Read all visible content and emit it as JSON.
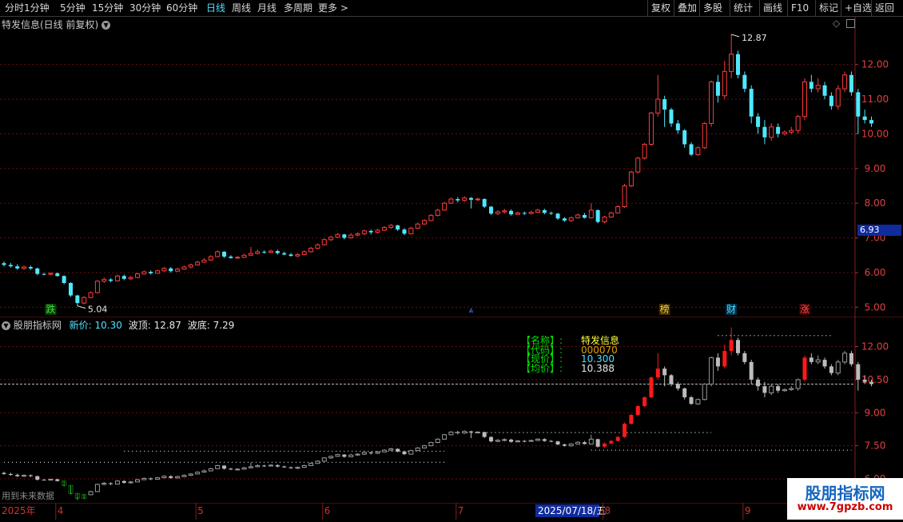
{
  "toolbar": {
    "left": [
      {
        "label": "分时",
        "active": false
      },
      {
        "label": "1分钟",
        "active": false
      },
      {
        "label": "5分钟",
        "active": false
      },
      {
        "label": "15分钟",
        "active": false
      },
      {
        "label": "30分钟",
        "active": false
      },
      {
        "label": "60分钟",
        "active": false
      },
      {
        "label": "日线",
        "active": true
      },
      {
        "label": "周线",
        "active": false
      },
      {
        "label": "月线",
        "active": false
      },
      {
        "label": "多周期",
        "active": false
      },
      {
        "label": "更多 >",
        "active": false
      }
    ],
    "right": [
      {
        "label": "复权"
      },
      {
        "label": "叠加"
      },
      {
        "label": "多股"
      },
      {
        "label": "统计"
      },
      {
        "label": "画线"
      },
      {
        "label": "F10"
      },
      {
        "label": "标记"
      },
      {
        "label": "+自选"
      },
      {
        "label": "返回"
      }
    ]
  },
  "main_header": {
    "title": "特发信息(日线 前复权)"
  },
  "sub_header": {
    "name": "股朋指标网",
    "price_label": "新价: 10.30",
    "peak_label": "波顶: 12.87",
    "trough_label": "波底: 7.29"
  },
  "info_box": [
    {
      "key": "【名称】:",
      "value": "特发信息",
      "color": "#ffff40"
    },
    {
      "key": "【代码】:",
      "value": "000070",
      "color": "#e0a000"
    },
    {
      "key": "【现价】:",
      "value": "10.300",
      "color": "#4fe0ff"
    },
    {
      "key": "【均价】:",
      "value": "10.388",
      "color": "#e8e8e8"
    }
  ],
  "future_label": "用到未来数据",
  "current_price_tag": "6.93",
  "watermark": {
    "title": "股朋指标网",
    "url": "www.7gpzb.com"
  },
  "main_markers": [
    {
      "text": "跌",
      "color": "#3ce03c",
      "bg": "#0a3a0a",
      "index": 7
    },
    {
      "text": "榜",
      "color": "#ffd040",
      "bg": "#3a2a00",
      "index": 99
    },
    {
      "text": "财",
      "color": "#4fe0ff",
      "bg": "#00304a",
      "index": 109
    },
    {
      "text": "涨",
      "color": "#ff5050",
      "bg": "#3a0000",
      "index": 120
    }
  ],
  "main_annotations": {
    "high": "12.87",
    "low": "5.04"
  },
  "time_axis": {
    "labels": [
      {
        "text": "2025年",
        "index": 0
      },
      {
        "text": "4",
        "index": 8
      },
      {
        "text": "5",
        "index": 29
      },
      {
        "text": "6",
        "index": 48
      },
      {
        "text": "7",
        "index": 68
      },
      {
        "text": "2025/07/18/五",
        "index": 80,
        "highlight": true
      },
      {
        "text": "8",
        "index": 90
      },
      {
        "text": "9",
        "index": 111
      }
    ]
  },
  "chart_data": {
    "type": "candlestick",
    "main_y_ticks": [
      5.0,
      6.0,
      7.0,
      8.0,
      9.0,
      10.0,
      11.0,
      12.0
    ],
    "main_ylim": [
      4.8,
      13.1
    ],
    "sub_y_ticks": [
      6.0,
      7.5,
      9.0,
      10.5,
      12.0
    ],
    "sub_ylim": [
      6.0,
      13.0
    ],
    "sub_ref_line": 10.3,
    "peak": 12.87,
    "trough": 7.29,
    "candles": [
      [
        6.27,
        6.22,
        6.32,
        6.18
      ],
      [
        6.22,
        6.18,
        6.28,
        6.14
      ],
      [
        6.18,
        6.12,
        6.24,
        6.08
      ],
      [
        6.12,
        6.16,
        6.2,
        6.08
      ],
      [
        6.16,
        6.12,
        6.2,
        6.08
      ],
      [
        6.12,
        5.96,
        6.14,
        5.92
      ],
      [
        5.96,
        5.95,
        5.99,
        5.92
      ],
      [
        5.95,
        5.98,
        6.0,
        5.92
      ],
      [
        5.98,
        5.9,
        6.0,
        5.88
      ],
      [
        5.9,
        5.7,
        5.92,
        5.66
      ],
      [
        5.7,
        5.34,
        5.72,
        5.3
      ],
      [
        5.34,
        5.12,
        5.36,
        5.04
      ],
      [
        5.12,
        5.28,
        5.32,
        5.08
      ],
      [
        5.28,
        5.42,
        5.46,
        5.26
      ],
      [
        5.42,
        5.75,
        5.78,
        5.4
      ],
      [
        5.75,
        5.8,
        5.86,
        5.7
      ],
      [
        5.8,
        5.76,
        5.84,
        5.72
      ],
      [
        5.76,
        5.9,
        5.94,
        5.74
      ],
      [
        5.9,
        5.82,
        5.94,
        5.78
      ],
      [
        5.82,
        5.86,
        5.9,
        5.78
      ],
      [
        5.86,
        5.96,
        6.0,
        5.84
      ],
      [
        5.96,
        6.02,
        6.06,
        5.94
      ],
      [
        6.02,
        5.98,
        6.06,
        5.94
      ],
      [
        5.98,
        6.05,
        6.08,
        5.96
      ],
      [
        6.05,
        6.12,
        6.16,
        6.02
      ],
      [
        6.12,
        6.04,
        6.16,
        6.0
      ],
      [
        6.04,
        6.1,
        6.14,
        6.02
      ],
      [
        6.1,
        6.16,
        6.2,
        6.08
      ],
      [
        6.16,
        6.22,
        6.26,
        6.12
      ],
      [
        6.22,
        6.3,
        6.34,
        6.2
      ],
      [
        6.3,
        6.36,
        6.42,
        6.28
      ],
      [
        6.36,
        6.46,
        6.5,
        6.34
      ],
      [
        6.46,
        6.6,
        6.64,
        6.44
      ],
      [
        6.6,
        6.46,
        6.62,
        6.42
      ],
      [
        6.46,
        6.42,
        6.5,
        6.4
      ],
      [
        6.42,
        6.44,
        6.48,
        6.4
      ],
      [
        6.44,
        6.5,
        6.54,
        6.42
      ],
      [
        6.5,
        6.55,
        6.74,
        6.48
      ],
      [
        6.55,
        6.6,
        6.66,
        6.52
      ],
      [
        6.6,
        6.58,
        6.64,
        6.54
      ],
      [
        6.58,
        6.62,
        6.66,
        6.56
      ],
      [
        6.62,
        6.56,
        6.66,
        6.52
      ],
      [
        6.56,
        6.52,
        6.6,
        6.5
      ],
      [
        6.52,
        6.48,
        6.56,
        6.46
      ],
      [
        6.48,
        6.52,
        6.56,
        6.44
      ],
      [
        6.52,
        6.6,
        6.64,
        6.5
      ],
      [
        6.6,
        6.7,
        6.74,
        6.58
      ],
      [
        6.7,
        6.8,
        6.84,
        6.68
      ],
      [
        6.8,
        6.95,
        6.98,
        6.78
      ],
      [
        6.95,
        7.02,
        7.06,
        6.9
      ],
      [
        7.02,
        7.1,
        7.14,
        7.0
      ],
      [
        7.1,
        7.0,
        7.12,
        6.96
      ],
      [
        7.0,
        7.08,
        7.14,
        6.98
      ],
      [
        7.08,
        7.12,
        7.16,
        7.04
      ],
      [
        7.12,
        7.2,
        7.24,
        7.08
      ],
      [
        7.2,
        7.16,
        7.24,
        7.1
      ],
      [
        7.16,
        7.22,
        7.26,
        7.12
      ],
      [
        7.22,
        7.3,
        7.34,
        7.2
      ],
      [
        7.3,
        7.36,
        7.4,
        7.26
      ],
      [
        7.36,
        7.24,
        7.38,
        7.2
      ],
      [
        7.24,
        7.12,
        7.28,
        7.08
      ],
      [
        7.12,
        7.28,
        7.32,
        7.1
      ],
      [
        7.28,
        7.4,
        7.44,
        7.26
      ],
      [
        7.4,
        7.5,
        7.54,
        7.38
      ],
      [
        7.5,
        7.65,
        7.68,
        7.48
      ],
      [
        7.65,
        7.8,
        7.84,
        7.62
      ],
      [
        7.8,
        8.0,
        8.04,
        7.78
      ],
      [
        8.0,
        8.12,
        8.16,
        7.98
      ],
      [
        8.12,
        8.08,
        8.18,
        8.02
      ],
      [
        8.08,
        8.15,
        8.2,
        8.04
      ],
      [
        8.15,
        8.1,
        8.18,
        7.85
      ],
      [
        8.1,
        8.12,
        8.16,
        8.06
      ],
      [
        8.12,
        7.9,
        8.14,
        7.86
      ],
      [
        7.9,
        7.7,
        7.92,
        7.66
      ],
      [
        7.7,
        7.75,
        7.8,
        7.66
      ],
      [
        7.75,
        7.78,
        7.84,
        7.7
      ],
      [
        7.78,
        7.68,
        7.82,
        7.64
      ],
      [
        7.68,
        7.72,
        7.76,
        7.66
      ],
      [
        7.72,
        7.7,
        7.76,
        7.66
      ],
      [
        7.7,
        7.74,
        7.78,
        7.68
      ],
      [
        7.74,
        7.8,
        7.84,
        7.72
      ],
      [
        7.8,
        7.72,
        7.84,
        7.68
      ],
      [
        7.72,
        7.7,
        7.76,
        7.66
      ],
      [
        7.7,
        7.56,
        7.72,
        7.52
      ],
      [
        7.56,
        7.5,
        7.6,
        7.46
      ],
      [
        7.5,
        7.58,
        7.62,
        7.46
      ],
      [
        7.58,
        7.66,
        7.7,
        7.56
      ],
      [
        7.66,
        7.58,
        7.72,
        7.56
      ],
      [
        7.58,
        7.8,
        8.0,
        7.56
      ],
      [
        7.8,
        7.46,
        7.82,
        7.42
      ],
      [
        7.46,
        7.6,
        7.64,
        7.42
      ],
      [
        7.6,
        7.72,
        7.76,
        7.58
      ],
      [
        7.72,
        7.9,
        7.94,
        7.7
      ],
      [
        7.9,
        8.5,
        8.56,
        7.86
      ],
      [
        8.5,
        8.9,
        8.94,
        8.46
      ],
      [
        8.9,
        9.3,
        9.34,
        8.86
      ],
      [
        9.3,
        9.7,
        9.74,
        9.26
      ],
      [
        9.7,
        10.6,
        10.64,
        9.66
      ],
      [
        10.6,
        11.0,
        11.7,
        10.5
      ],
      [
        11.0,
        10.7,
        11.1,
        10.2
      ],
      [
        10.7,
        10.3,
        10.75,
        10.2
      ],
      [
        10.3,
        10.1,
        10.4,
        10.0
      ],
      [
        10.1,
        9.7,
        10.14,
        9.6
      ],
      [
        9.7,
        9.4,
        9.76,
        9.36
      ],
      [
        9.4,
        9.6,
        9.64,
        9.36
      ],
      [
        9.6,
        10.3,
        10.34,
        9.56
      ],
      [
        10.3,
        11.5,
        11.54,
        10.2
      ],
      [
        11.5,
        11.1,
        11.7,
        10.9
      ],
      [
        11.1,
        11.8,
        12.1,
        11.0
      ],
      [
        11.8,
        12.3,
        12.87,
        11.6
      ],
      [
        12.3,
        11.7,
        12.4,
        11.6
      ],
      [
        11.7,
        11.3,
        11.8,
        11.2
      ],
      [
        11.3,
        10.5,
        11.4,
        10.3
      ],
      [
        10.5,
        10.2,
        10.6,
        10.0
      ],
      [
        10.2,
        9.9,
        10.4,
        9.7
      ],
      [
        9.9,
        10.2,
        10.3,
        9.8
      ],
      [
        10.2,
        10.0,
        10.3,
        9.9
      ],
      [
        10.0,
        10.05,
        10.1,
        9.95
      ],
      [
        10.05,
        10.1,
        10.2,
        10.0
      ],
      [
        10.1,
        10.5,
        10.55,
        10.0
      ],
      [
        10.5,
        11.5,
        11.6,
        10.4
      ],
      [
        11.5,
        11.3,
        11.7,
        11.2
      ],
      [
        11.3,
        11.4,
        11.6,
        11.2
      ],
      [
        11.4,
        11.1,
        11.5,
        11.0
      ],
      [
        11.1,
        10.8,
        11.2,
        10.7
      ],
      [
        10.8,
        11.3,
        11.4,
        10.7
      ],
      [
        11.3,
        11.7,
        11.8,
        11.2
      ],
      [
        11.7,
        11.2,
        11.8,
        11.1
      ],
      [
        11.2,
        10.5,
        11.3,
        10.0
      ],
      [
        10.5,
        10.4,
        10.7,
        10.3
      ],
      [
        10.4,
        10.3,
        10.5,
        10.2
      ]
    ]
  }
}
